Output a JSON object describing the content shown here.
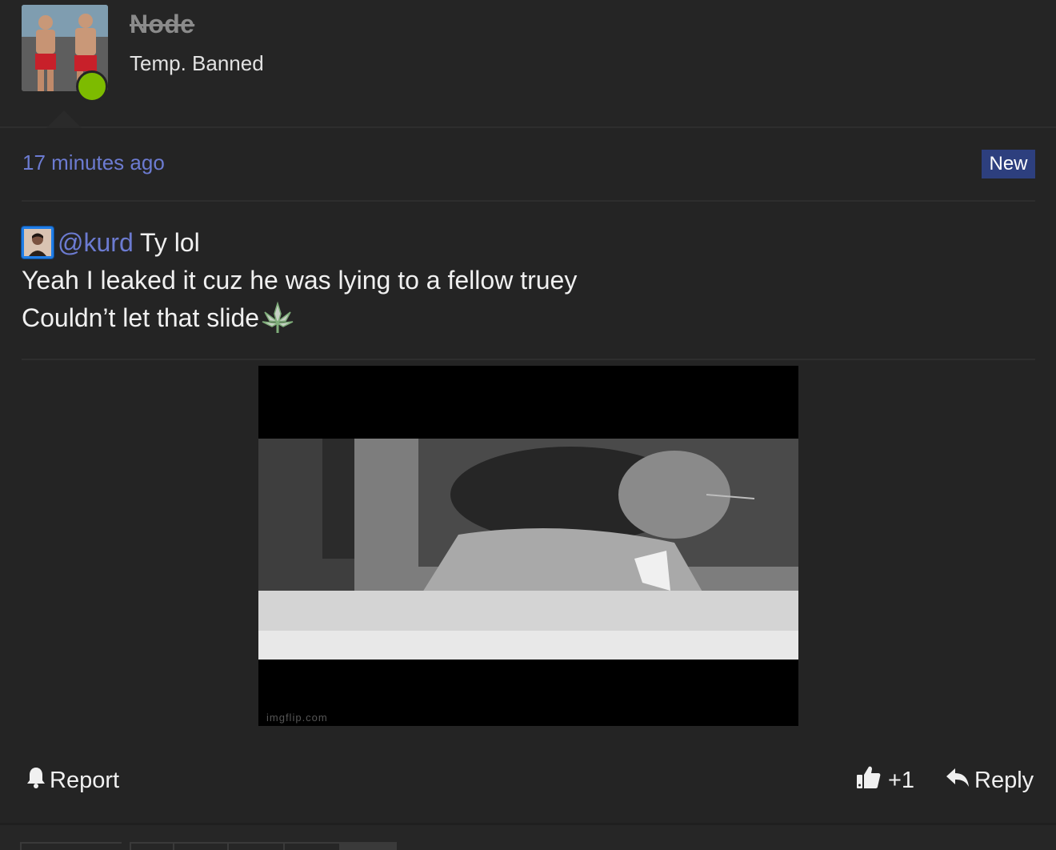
{
  "user": {
    "name": "Node",
    "title": "Temp. Banned",
    "status_color": "#7dbb00"
  },
  "post": {
    "timestamp": "17 minutes ago",
    "badge": "New",
    "mention": "@kurd",
    "line1_text": " Ty lol",
    "line2": "Yeah I leaked it cuz he was lying to a fellow truey",
    "line3": "Couldn’t let that slide",
    "emoji": "leaf-icon",
    "media_watermark": "imgflip.com"
  },
  "actions": {
    "report_label": "Report",
    "like_label": "+1",
    "reply_label": "Reply"
  },
  "colors": {
    "background": "#242424",
    "link": "#6c7bd1",
    "badge": "#2d3f7e"
  }
}
